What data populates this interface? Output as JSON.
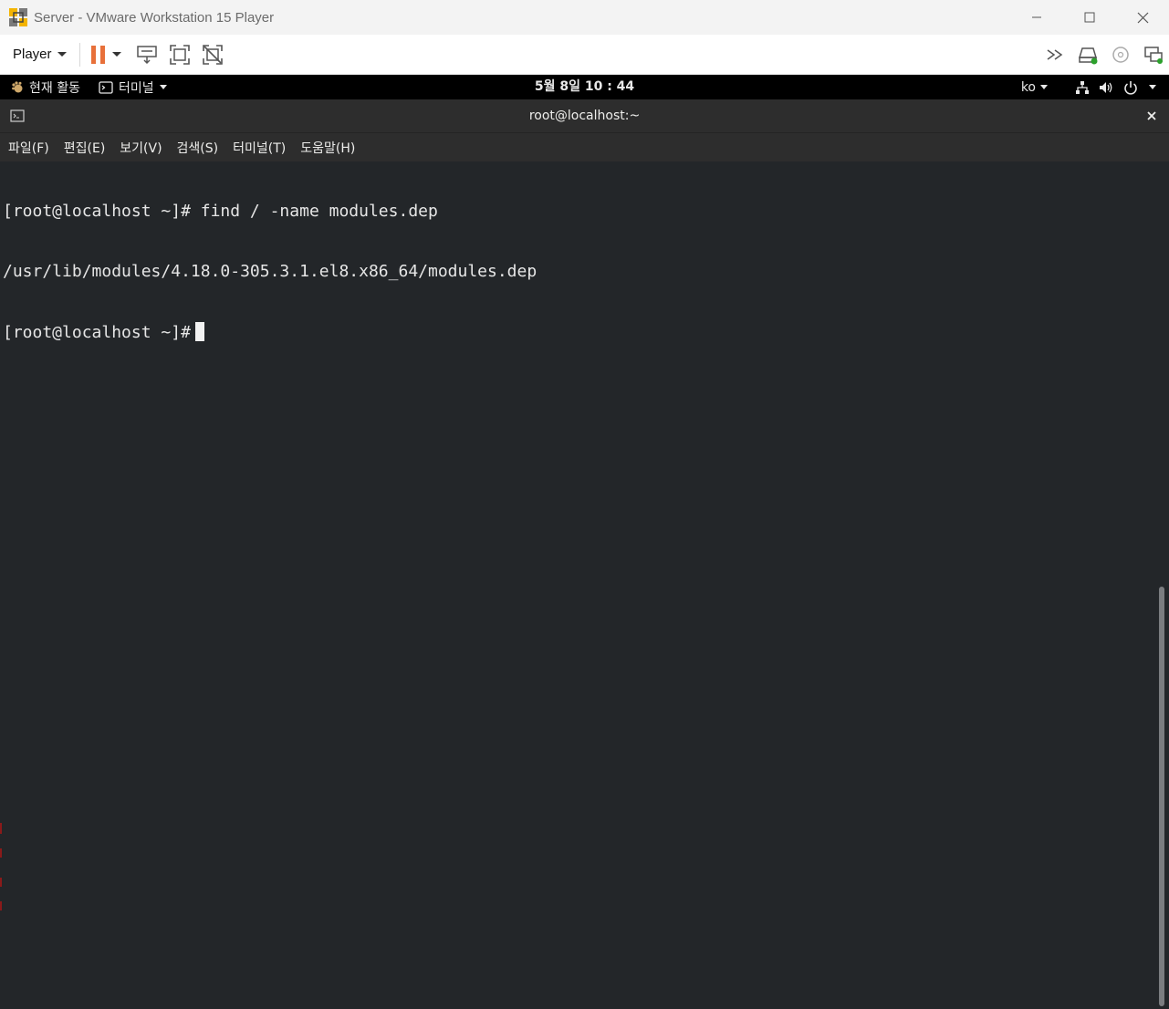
{
  "host": {
    "title": "Server - VMware Workstation 15 Player",
    "player_label": "Player"
  },
  "gnome": {
    "activities": "현재 활동",
    "app_menu": "터미널",
    "clock": "5월 8일  10 : 44",
    "input_method": "ko"
  },
  "terminal": {
    "title": "root@localhost:~",
    "menu": [
      "파일(F)",
      "편집(E)",
      "보기(V)",
      "검색(S)",
      "터미널(T)",
      "도움말(H)"
    ],
    "lines": [
      "[root@localhost ~]# find / -name modules.dep",
      "/usr/lib/modules/4.18.0-305.3.1.el8.x86_64/modules.dep",
      "[root@localhost ~]#"
    ]
  },
  "colors": {
    "pause_accent": "#e8703a",
    "terminal_bg": "#232629",
    "header_bg": "#2d2d2d",
    "gnome_bar_bg": "#000000"
  }
}
